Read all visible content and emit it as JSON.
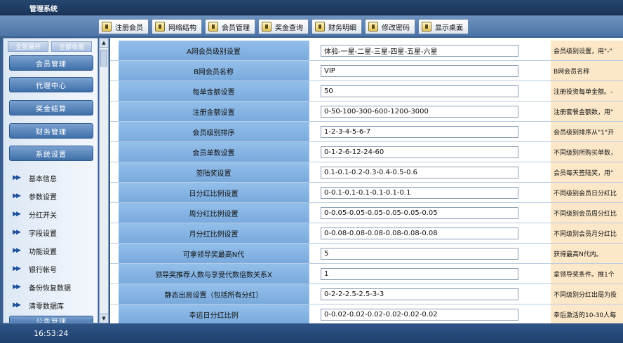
{
  "app": {
    "title": "管理系统"
  },
  "toolbar": {
    "buttons": [
      {
        "label": "注册会员",
        "icon": "register-icon"
      },
      {
        "label": "网络结构",
        "icon": "network-icon"
      },
      {
        "label": "会员管理",
        "icon": "member-icon"
      },
      {
        "label": "奖金查询",
        "icon": "bonus-icon"
      },
      {
        "label": "财务明细",
        "icon": "finance-icon"
      },
      {
        "label": "修改密码",
        "icon": "password-icon"
      },
      {
        "label": "显示桌面",
        "icon": "desktop-icon"
      }
    ]
  },
  "sidebar": {
    "expand_all": "全部展开",
    "collapse_all": "全部收缩",
    "menus": [
      {
        "label": "会员管理"
      },
      {
        "label": "代理中心"
      },
      {
        "label": "奖金结算"
      },
      {
        "label": "财务管理"
      },
      {
        "label": "系统设置"
      }
    ],
    "sub_items": [
      {
        "label": "基本信息"
      },
      {
        "label": "参数设置"
      },
      {
        "label": "分红开关"
      },
      {
        "label": "字段设置"
      },
      {
        "label": "功能设置"
      },
      {
        "label": "银行帐号"
      },
      {
        "label": "备份恢复数据"
      },
      {
        "label": "清零数据库"
      }
    ],
    "partial_menu": "公告管理"
  },
  "settings": {
    "rows": [
      {
        "label": "A网会员级别设置",
        "value": "体验-一星-二星-三星-四星-五星-六星",
        "desc": "会员级别设置，用\"-\""
      },
      {
        "label": "B网会员名称",
        "value": "VIP",
        "desc": "B网会员名称"
      },
      {
        "label": "每单金额设置",
        "value": "50",
        "desc": "注册投资每单金额。-"
      },
      {
        "label": "注册金额设置",
        "value": "0-50-100-300-600-1200-3000",
        "desc": "注册套餐金额数，用\""
      },
      {
        "label": "会员级别排序",
        "value": "1-2-3-4-5-6-7",
        "desc": "会员级别排序从\"1\"开"
      },
      {
        "label": "会员单数设置",
        "value": "0-1-2-6-12-24-60",
        "desc": "不同级别所购买单数，"
      },
      {
        "label": "签陆奖设置",
        "value": "0.1-0.1-0.2-0.3-0.4-0.5-0.6",
        "desc": "会员每天签陆奖，用\""
      },
      {
        "label": "日分红比例设置",
        "value": "0-0.1-0.1-0.1-0.1-0.1-0.1",
        "desc": "不同级别会员日分红比"
      },
      {
        "label": "周分红比例设置",
        "value": "0-0.05-0.05-0.05-0.05-0.05-0.05",
        "desc": "不同级别会员周分红比"
      },
      {
        "label": "月分红比例设置",
        "value": "0-0.08-0.08-0.08-0.08-0.08-0.08",
        "desc": "不同级别会员月分红比"
      },
      {
        "label": "可拿领导奖最高N代",
        "value": "5",
        "desc": "获得最高N代内。"
      },
      {
        "label": "领导奖推荐人数与享受代数倍数关系X",
        "value": "1",
        "desc": "拿领导奖条件。推1个"
      },
      {
        "label": "静态出局设置（包括所有分红）",
        "value": "0-2-2-2.5-2.5-3-3",
        "desc": "不同级别分红出局为投"
      },
      {
        "label": "幸运日分红比例",
        "value": "0-0.02-0.02-0.02-0.02-0.02-0.02",
        "desc": "幸后激活的10-30人每"
      }
    ]
  },
  "status": {
    "time": "16:53:24"
  }
}
